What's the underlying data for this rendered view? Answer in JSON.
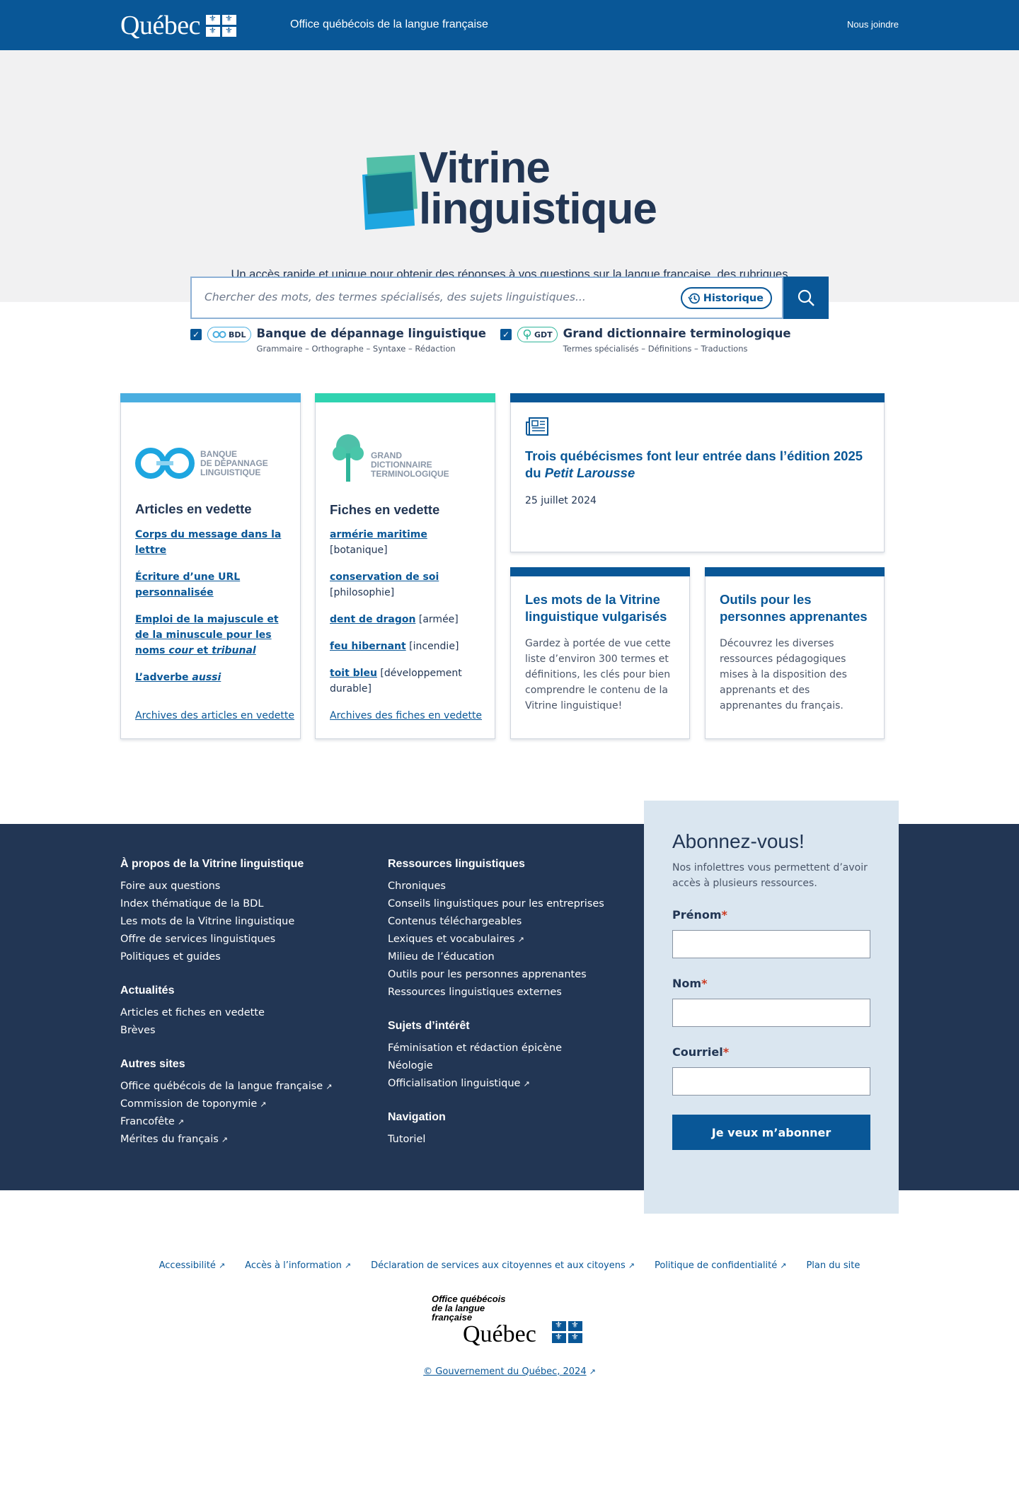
{
  "header": {
    "logo_text": "Québec",
    "site_title": "Office québécois de la langue française",
    "contact_label": "Nous joindre"
  },
  "hero": {
    "logo_line1": "Vitrine",
    "logo_line2": "linguistique",
    "description": "Un accès rapide et unique pour obtenir des réponses à vos questions sur la langue française, des rubriques linguistiques et des centaines de milliers de termes et de définitions."
  },
  "search": {
    "placeholder": "Chercher des mots, des termes spécialisés, des sujets linguistiques...",
    "history_label": "Historique"
  },
  "sources": [
    {
      "badge": "BDL",
      "title": "Banque de dépannage linguistique",
      "subtitle": "Grammaire – Orthographe – Syntaxe – Rédaction"
    },
    {
      "badge": "GDT",
      "title": "Grand dictionnaire terminologique",
      "subtitle": "Termes spécialisés – Définitions – Traductions"
    }
  ],
  "bdl_card": {
    "logo_caption": [
      "BANQUE",
      "DE DÉPANNAGE",
      "LINGUISTIQUE"
    ],
    "heading": "Articles en vedette",
    "items": [
      {
        "link": "Corps du message dans la lettre"
      },
      {
        "link": "Écriture d’une URL personnalisée"
      },
      {
        "link": "Emploi de la majuscule et de la minuscule pour les noms",
        "link_italic": "cour",
        "link_mid": " et ",
        "link_italic2": "tribunal"
      },
      {
        "link": "L’adverbe ",
        "link_italic": "aussi"
      }
    ],
    "archive": "Archives des articles en vedette"
  },
  "gdt_card": {
    "logo_caption": [
      "GRAND",
      "DICTIONNAIRE",
      "TERMINOLOGIQUE"
    ],
    "heading": "Fiches en vedette",
    "items": [
      {
        "link": "armérie maritime",
        "domain": "[botanique]"
      },
      {
        "link": "conservation de soi",
        "domain": "[philosophie]"
      },
      {
        "link": "dent de dragon",
        "domain": "[armée]"
      },
      {
        "link": "feu hibernant",
        "domain": "[incendie]"
      },
      {
        "link": "toit bleu",
        "domain": "[développement durable]"
      }
    ],
    "archive": "Archives des fiches en vedette"
  },
  "news_card": {
    "title": "Trois québécismes font leur entrée dans l’édition 2025 du",
    "title_italic": "Petit Larousse",
    "date": "25 juillet 2024"
  },
  "vulgar_card": {
    "title": "Les mots de la Vitrine linguistique vulgarisés",
    "text": "Gardez à portée de vue cette liste d’environ 300 termes et définitions, les clés pour bien comprendre le contenu de la Vitrine linguistique!"
  },
  "learners_card": {
    "title": "Outils pour les personnes apprenantes",
    "text": "Découvrez les diverses ressources pédagogiques mises à la disposition des apprenants et des apprenantes du français."
  },
  "footer": {
    "col1": [
      {
        "heading": "À propos de la Vitrine linguistique",
        "links": [
          {
            "label": "Foire aux questions"
          },
          {
            "label": "Index thématique de la BDL"
          },
          {
            "label": "Les mots de la Vitrine linguistique"
          },
          {
            "label": "Offre de services linguistiques"
          },
          {
            "label": "Politiques et guides"
          }
        ]
      },
      {
        "heading": "Actualités",
        "links": [
          {
            "label": "Articles et fiches en vedette"
          },
          {
            "label": "Brèves"
          }
        ]
      },
      {
        "heading": "Autres sites",
        "links": [
          {
            "label": "Office québécois de la langue française",
            "external": true
          },
          {
            "label": "Commission de toponymie",
            "external": true
          },
          {
            "label": "Francofête",
            "external": true
          },
          {
            "label": "Mérites du français",
            "external": true
          }
        ]
      }
    ],
    "col2": [
      {
        "heading": "Ressources linguistiques",
        "links": [
          {
            "label": "Chroniques"
          },
          {
            "label": "Conseils linguistiques pour les entreprises"
          },
          {
            "label": "Contenus téléchargeables"
          },
          {
            "label": "Lexiques et vocabulaires",
            "external": true
          },
          {
            "label": "Milieu de l’éducation"
          },
          {
            "label": "Outils pour les personnes apprenantes"
          },
          {
            "label": "Ressources linguistiques externes"
          }
        ]
      },
      {
        "heading": "Sujets d’intérêt",
        "links": [
          {
            "label": "Féminisation et rédaction épicène"
          },
          {
            "label": "Néologie"
          },
          {
            "label": "Officialisation linguistique",
            "external": true
          }
        ]
      },
      {
        "heading": "Navigation",
        "links": [
          {
            "label": "Tutoriel"
          }
        ]
      }
    ]
  },
  "subscribe": {
    "heading": "Abonnez-vous!",
    "text": "Nos infolettres vous permettent d’avoir accès à plusieurs ressources.",
    "first_name_label": "Prénom",
    "last_name_label": "Nom",
    "email_label": "Courriel",
    "required_mark": "*",
    "button_label": "Je veux m’abonner"
  },
  "legal_links": [
    {
      "label": "Accessibilité",
      "external": true
    },
    {
      "label": "Accès à l’information",
      "external": true
    },
    {
      "label": "Déclaration de services aux citoyennes et aux citoyens",
      "external": true
    },
    {
      "label": "Politique de confidentialité",
      "external": true
    },
    {
      "label": "Plan du site",
      "external": false
    }
  ],
  "bottom_logo": {
    "caption": [
      "Office québécois",
      "de la langue",
      "française"
    ],
    "word": "Québec"
  },
  "copyright": "© Gouvernement du Québec, 2024",
  "colors": {
    "primary": "#095797",
    "dark": "#223654",
    "bdl_accent": "#4aaee0",
    "gdt_accent": "#2fb59a"
  }
}
